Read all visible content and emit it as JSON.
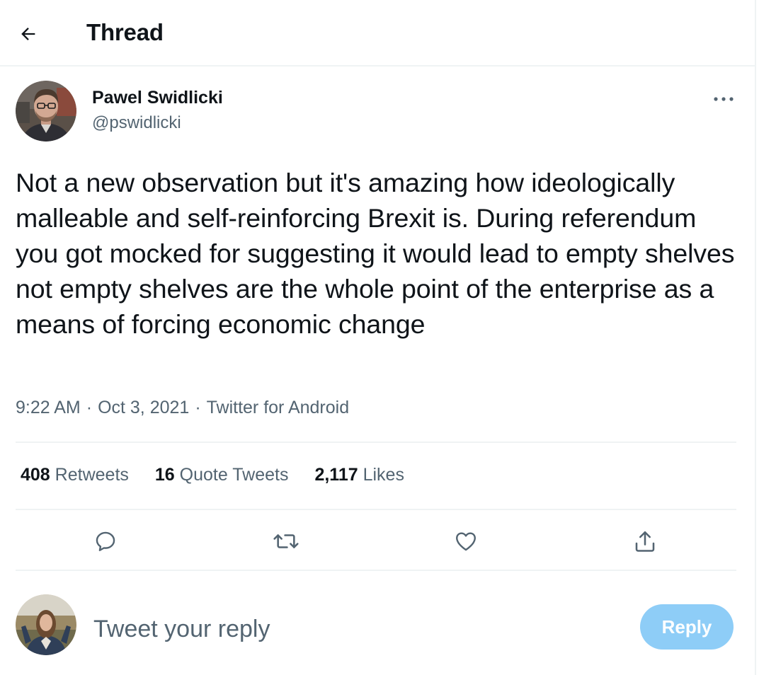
{
  "header": {
    "title": "Thread"
  },
  "tweet": {
    "author_name": "Pawel Swidlicki",
    "author_handle": "@pswidlicki",
    "text": "Not a new observation but it's amazing how ideologically malleable and self-reinforcing Brexit is. During referendum you got mocked for suggesting it would lead to empty shelves not empty shelves are the whole point of the enterprise as a means of forcing economic change",
    "time": "9:22 AM",
    "date": "Oct 3, 2021",
    "source": "Twitter for Android",
    "separator": "·"
  },
  "stats": {
    "retweets_count": "408",
    "retweets_label": "Retweets",
    "quotes_count": "16",
    "quotes_label": "Quote Tweets",
    "likes_count": "2,117",
    "likes_label": "Likes"
  },
  "actions": [
    "reply-icon",
    "retweet-icon",
    "like-icon",
    "share-icon"
  ],
  "composer": {
    "placeholder": "Tweet your reply",
    "reply_label": "Reply"
  },
  "colors": {
    "text": "#0f1419",
    "secondary": "#536471",
    "divider": "#eff3f4",
    "reply_button_disabled": "#8ecdf7"
  }
}
